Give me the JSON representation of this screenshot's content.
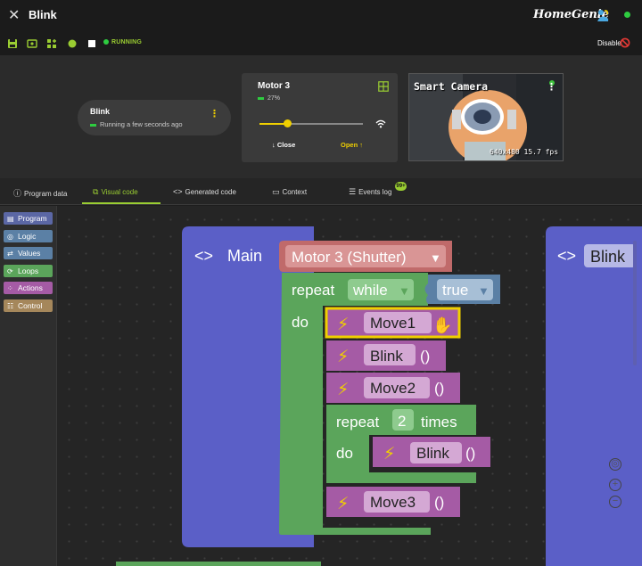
{
  "app": {
    "title": "Blink",
    "brand": "HomeGenie",
    "disable_label": "Disable",
    "status": "RUNNING"
  },
  "widgets": {
    "blink": {
      "name": "Blink",
      "status": "Running a few seconds ago"
    },
    "motor": {
      "name": "Motor 3",
      "percent_label": "27%",
      "level": 0.27,
      "close_label": "Close",
      "open_label": "Open"
    },
    "camera": {
      "title": "Smart Camera",
      "info": "640x480 15.7 fps"
    }
  },
  "tabs": [
    {
      "label": "Program data",
      "icon": "info-icon"
    },
    {
      "label": "Visual code",
      "icon": "blocks-icon"
    },
    {
      "label": "Generated code",
      "icon": "code-icon"
    },
    {
      "label": "Context",
      "icon": "context-icon"
    },
    {
      "label": "Events log",
      "icon": "list-icon",
      "badge": "99+"
    }
  ],
  "categories": [
    {
      "label": "Program",
      "color": "#5b67a5"
    },
    {
      "label": "Logic",
      "color": "#5b80a5"
    },
    {
      "label": "Values",
      "color": "#5b80a5"
    },
    {
      "label": "Loops",
      "color": "#5ba55b"
    },
    {
      "label": "Actions",
      "color": "#a55ba5"
    },
    {
      "label": "Control",
      "color": "#a5875b"
    }
  ],
  "blocks": {
    "main_label": "Main",
    "device": "Motor 3 (Shutter)",
    "repeat": "repeat",
    "while": "while",
    "true": "true",
    "do": "do",
    "move1": "Move1",
    "blink": "Blink",
    "parens": "()",
    "move2": "Move2",
    "repeat_count": "2",
    "times": "times",
    "move3": "Move3",
    "side_label": "Blink"
  },
  "colors": {
    "accent": "#9acd32",
    "yellow": "#f0d000",
    "program": "#5b5fc7",
    "loops": "#5ba55b",
    "actions": "#a55ba5",
    "device": "#c06a6a",
    "logic": "#5b80a5"
  }
}
